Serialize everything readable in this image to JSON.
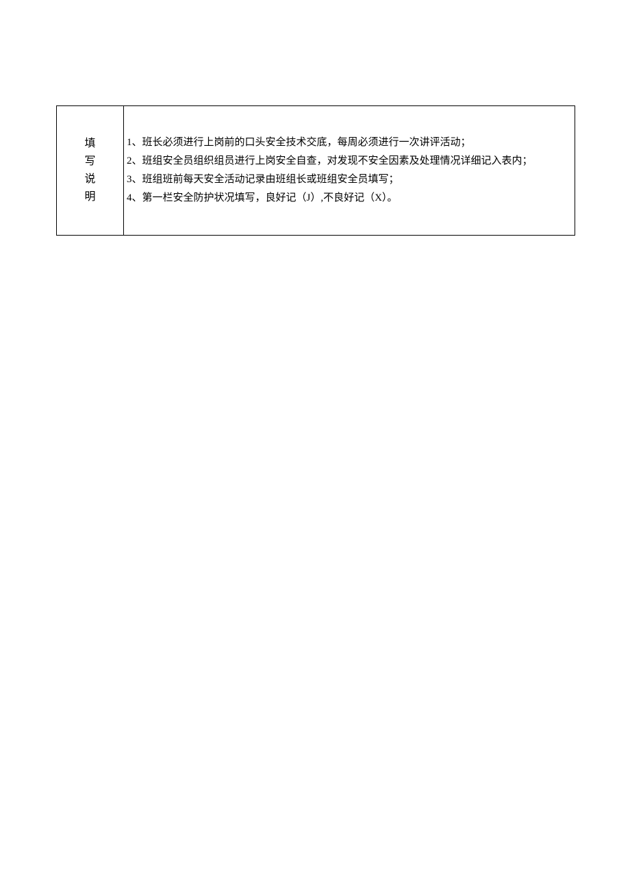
{
  "label": {
    "c1": "填",
    "c2": "写",
    "c3": "说",
    "c4": "明"
  },
  "instructions": {
    "line1": "1、班长必须进行上岗前的口头安全技术交底，每周必须进行一次讲评活动；",
    "line2": "2、班组安全员组织组员进行上岗安全自查，对发现不安全因素及处理情况详细记入表内；",
    "line3": "3、班组班前每天安全活动记录由班组长或班组安全员填写；",
    "line4": "4、第一栏安全防护状况填写，良好记（J）,不良好记（X）。"
  }
}
